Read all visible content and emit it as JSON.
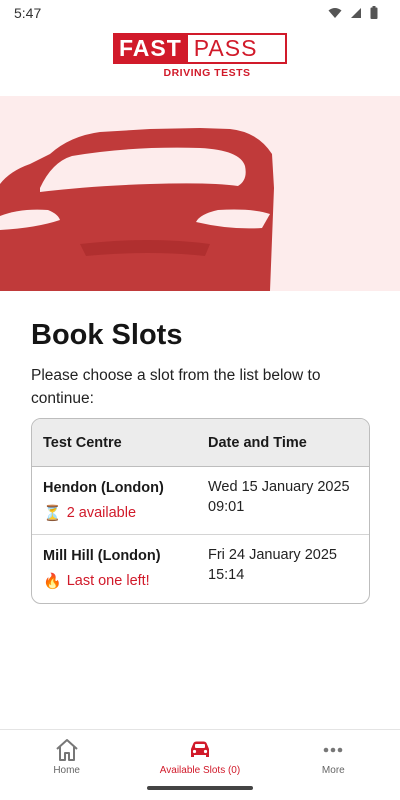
{
  "status_bar": {
    "time": "5:47"
  },
  "brand": {
    "logo_left": "FAST",
    "logo_right": "PASS",
    "tagline": "DRIVING TESTS"
  },
  "colors": {
    "brand_red": "#d11a2a",
    "hero_bg": "#fdecec",
    "car": "#c03a3a"
  },
  "page": {
    "title": "Book Slots",
    "description": "Please choose a slot from the list below to continue:"
  },
  "table": {
    "headers": [
      "Test Centre",
      "Date and Time"
    ],
    "rows": [
      {
        "centre": "Hendon (London)",
        "availability_icon": "⏳",
        "availability": "2 available",
        "date": "Wed 15 January 2025",
        "time": "09:01"
      },
      {
        "centre": "Mill Hill (London)",
        "availability_icon": "🔥",
        "availability": "Last one left!",
        "date": "Fri 24 January 2025",
        "time": "15:14"
      }
    ]
  },
  "nav": {
    "items": [
      {
        "label": "Home",
        "icon": "home-icon",
        "active": false
      },
      {
        "label": "Available Slots (0)",
        "icon": "car-icon",
        "active": true
      },
      {
        "label": "More",
        "icon": "more-dots-icon",
        "active": false
      }
    ]
  }
}
